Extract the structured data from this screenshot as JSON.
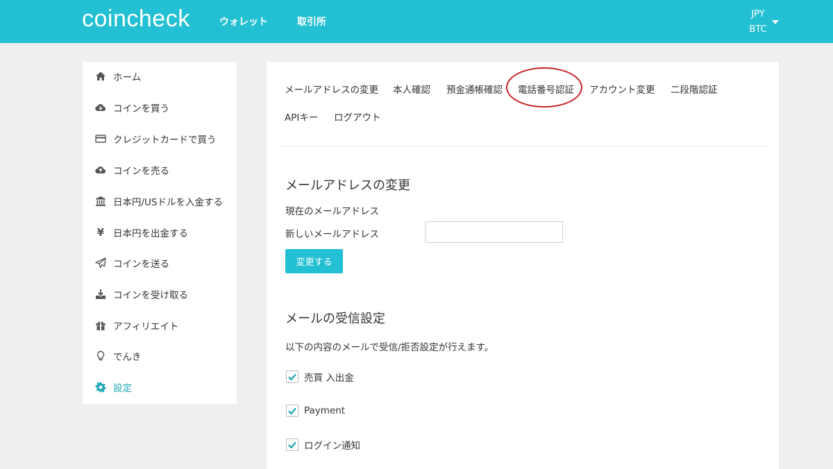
{
  "header": {
    "logo": "coincheck",
    "nav": [
      {
        "label": "ウォレット"
      },
      {
        "label": "取引所"
      }
    ],
    "currency_top": "JPY",
    "currency_bottom": "BTC"
  },
  "sidebar": {
    "items": [
      {
        "label": "ホーム",
        "icon": "home-icon"
      },
      {
        "label": "コインを買う",
        "icon": "cloud-download-icon"
      },
      {
        "label": "クレジットカードで買う",
        "icon": "credit-card-icon"
      },
      {
        "label": "コインを売る",
        "icon": "cloud-upload-icon"
      },
      {
        "label": "日本円/USドルを入金する",
        "icon": "bank-icon"
      },
      {
        "label": "日本円を出金する",
        "icon": "yen-icon",
        "glyph": "¥"
      },
      {
        "label": "コインを送る",
        "icon": "paper-plane-icon"
      },
      {
        "label": "コインを受け取る",
        "icon": "download-tray-icon"
      },
      {
        "label": "アフィリエイト",
        "icon": "gift-icon"
      },
      {
        "label": "でんき",
        "icon": "lightbulb-icon"
      },
      {
        "label": "設定",
        "icon": "gear-icon",
        "active": true
      }
    ]
  },
  "tabs": [
    {
      "label": "メールアドレスの変更"
    },
    {
      "label": "本人確認"
    },
    {
      "label": "預金通帳確認"
    },
    {
      "label": "電話番号認証",
      "highlighted": true
    },
    {
      "label": "アカウント変更"
    },
    {
      "label": "二段階認証"
    },
    {
      "label": "APIキー"
    },
    {
      "label": "ログアウト"
    }
  ],
  "email_section": {
    "title": "メールアドレスの変更",
    "current_label": "現在のメールアドレス",
    "new_label": "新しいメールアドレス",
    "new_value": "",
    "submit_label": "変更する"
  },
  "mail_settings": {
    "title": "メールの受信設定",
    "description": "以下の内容のメールで受信/拒否設定が行えます。",
    "options": [
      {
        "label": "売買 入出金",
        "checked": true
      },
      {
        "label": "Payment",
        "checked": true
      },
      {
        "label": "ログイン通知",
        "checked": true
      }
    ]
  },
  "colors": {
    "brand": "#23bfd2",
    "active": "#23a8b8",
    "highlight_ring": "#c8201f"
  }
}
